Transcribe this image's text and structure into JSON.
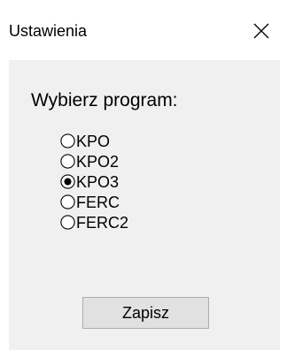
{
  "window": {
    "title": "Ustawienia",
    "close_icon": "close-icon"
  },
  "settings": {
    "group_label": "Wybierz program:",
    "options": [
      {
        "label": "KPO",
        "selected": false
      },
      {
        "label": "KPO2",
        "selected": false
      },
      {
        "label": "KPO3",
        "selected": true
      },
      {
        "label": "FERC",
        "selected": false
      },
      {
        "label": "FERC2",
        "selected": false
      }
    ],
    "save_label": "Zapisz"
  },
  "colors": {
    "client_background": "#f0f0f0",
    "button_background": "#e1e1e1",
    "button_border": "#adadad",
    "text": "#000000"
  }
}
